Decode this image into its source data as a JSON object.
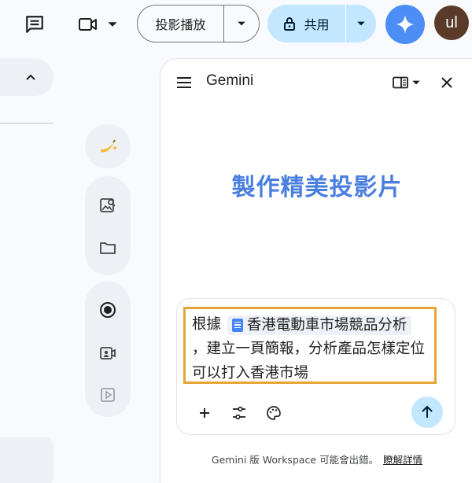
{
  "toolbar": {
    "comment_icon": "comment-icon",
    "meet_icon": "video-camera-icon",
    "slideshow_label": "投影播放",
    "share_label": "共用",
    "gemini_icon": "gemini-sparkle-icon",
    "avatar_initials": "ul"
  },
  "rail": {
    "items": [
      "nano-banana-icon",
      "image-search-icon",
      "folder-icon",
      "record-icon",
      "camera-icon",
      "video-slide-icon"
    ]
  },
  "panel": {
    "title": "Gemini",
    "hero_text": "製作精美投影片",
    "prompt": {
      "prefix": "根據",
      "file_chip": "香港電動車市場競品分析",
      "suffix": "，建立一頁簡報，分析產品怎樣定位可以打入香港市場"
    },
    "disclaimer": "Gemini 版 Workspace 可能會出錯。",
    "learn_more": "瞭解詳情"
  },
  "colors": {
    "accent": "#4a7fe0",
    "share_bg": "#c2e7ff",
    "highlight_border": "#e8a33a"
  }
}
